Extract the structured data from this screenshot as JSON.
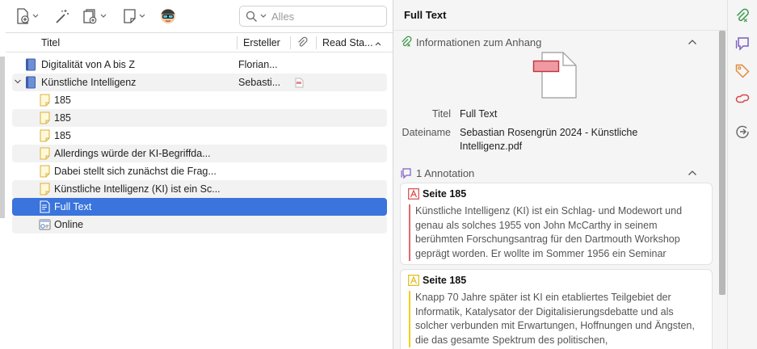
{
  "toolbar": {
    "new_item_icon": "new-item-icon",
    "magic_wand_icon": "magic-wand-icon",
    "add_attachment_icon": "add-attachment-icon",
    "new_note_icon": "new-note-icon",
    "avatar_icon": "avatar-icon"
  },
  "search": {
    "placeholder": "Alles"
  },
  "columns": {
    "title": "Titel",
    "creator": "Ersteller",
    "read_status": "Read Sta..."
  },
  "items": [
    {
      "type": "book",
      "label": "Digitalität von A bis Z",
      "creator": "Florian...",
      "twisty": "",
      "indent": 0
    },
    {
      "type": "book",
      "label": "Künstliche Intelligenz",
      "creator": "Sebasti...",
      "twisty": "expanded",
      "indent": 0,
      "has_pdf": true
    },
    {
      "type": "note",
      "label": "185",
      "creator": "",
      "indent": 1
    },
    {
      "type": "note",
      "label": "185",
      "creator": "",
      "indent": 1
    },
    {
      "type": "note",
      "label": "185",
      "creator": "",
      "indent": 1
    },
    {
      "type": "note",
      "label": "Allerdings würde der KI-Begriffda...",
      "creator": "",
      "indent": 1
    },
    {
      "type": "note",
      "label": "Dabei stellt sich zunächst die Frag...",
      "creator": "",
      "indent": 1
    },
    {
      "type": "note",
      "label": "Künstliche Intelligenz (KI) ist ein Sc...",
      "creator": "",
      "indent": 1
    },
    {
      "type": "fulltext",
      "label": "Full Text",
      "creator": "",
      "indent": 1,
      "selected": true
    },
    {
      "type": "web",
      "label": "Online",
      "creator": "",
      "indent": 1
    }
  ],
  "pane": {
    "title": "Full Text",
    "attachment_section": "Informationen zum Anhang",
    "meta": {
      "title_label": "Titel",
      "title_value": "Full Text",
      "filename_label": "Dateiname",
      "filename_value": "Sebastian Rosengrün 2024 - Künstliche Intelligenz.pdf"
    },
    "annotation_section": "1 Annotation",
    "annotations": [
      {
        "color": "#e06a6a",
        "page": "Seite 185",
        "text": "Künstliche Intelligenz (KI) ist ein Schlag- und Modewort und genau als solches 1955 von John McCarthy in seinem berühmten Forschungsantrag für den Dartmouth Workshop geprägt worden. Er wollte im Sommer 1956 ein Seminar"
      },
      {
        "color": "#f2cf1c",
        "page": "Seite 185",
        "text": "Knapp 70 Jahre später ist KI ein etabliertes Teilgebiet der Informatik, Katalysator der Digitalisierungsdebatte und als solcher verbunden mit Erwartungen, Hoffnungen und Ängsten, die das gesamte Spektrum des politischen,"
      }
    ]
  },
  "sidenav": [
    "attachment-icon",
    "notes-icon",
    "tag-icon",
    "related-icon",
    "locate-icon"
  ],
  "colors": {
    "selection": "#3a74dc",
    "accent_green": "#3c9a4a",
    "accent_purple": "#7c5cc4",
    "accent_orange": "#e08a3a"
  }
}
